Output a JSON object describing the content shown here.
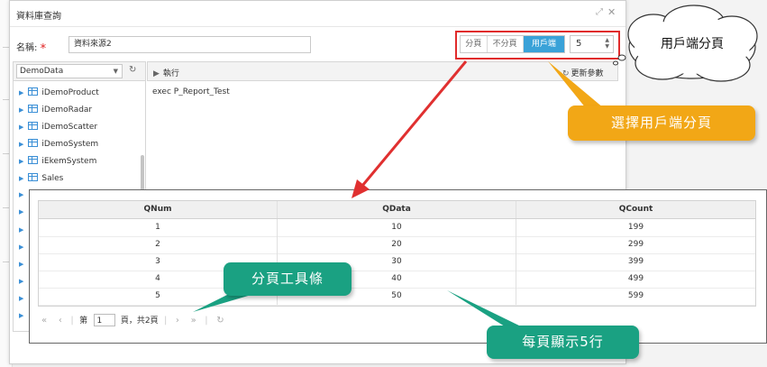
{
  "dialog": {
    "title": "資料庫查詢"
  },
  "form": {
    "name_label": "名稱:",
    "required_mark": "*",
    "name_value": "資料來源2"
  },
  "paging": {
    "options": [
      "分頁",
      "不分頁",
      "用戶端"
    ],
    "selected": "用戶端",
    "page_size": "5"
  },
  "tree": {
    "database": "DemoData",
    "items": [
      "iDemoProduct",
      "iDemoRadar",
      "iDemoScatter",
      "iDemoSystem",
      "iEkemSystem",
      "Sales"
    ]
  },
  "query": {
    "run_label": "執行",
    "refresh_params_label": "更新參數",
    "sql": "exec P_Report_Test"
  },
  "grid": {
    "columns": [
      "QNum",
      "QData",
      "QCount"
    ],
    "rows": [
      [
        "1",
        "10",
        "199"
      ],
      [
        "2",
        "20",
        "299"
      ],
      [
        "3",
        "30",
        "399"
      ],
      [
        "4",
        "40",
        "499"
      ],
      [
        "5",
        "50",
        "599"
      ]
    ]
  },
  "pager": {
    "page_prefix": "第",
    "page_value": "1",
    "page_suffix": "頁，共2頁"
  },
  "callouts": {
    "client_paging": "用戶端分頁",
    "select_client_paging": "選擇用戶端分頁",
    "pager_toolbar": "分頁工具條",
    "rows_per_page": "每頁顯示5行"
  },
  "colors": {
    "accent_blue": "#3aa2d8",
    "highlight_red": "#e02b2b",
    "callout_orange": "#f2a716",
    "callout_green": "#1aa182"
  }
}
